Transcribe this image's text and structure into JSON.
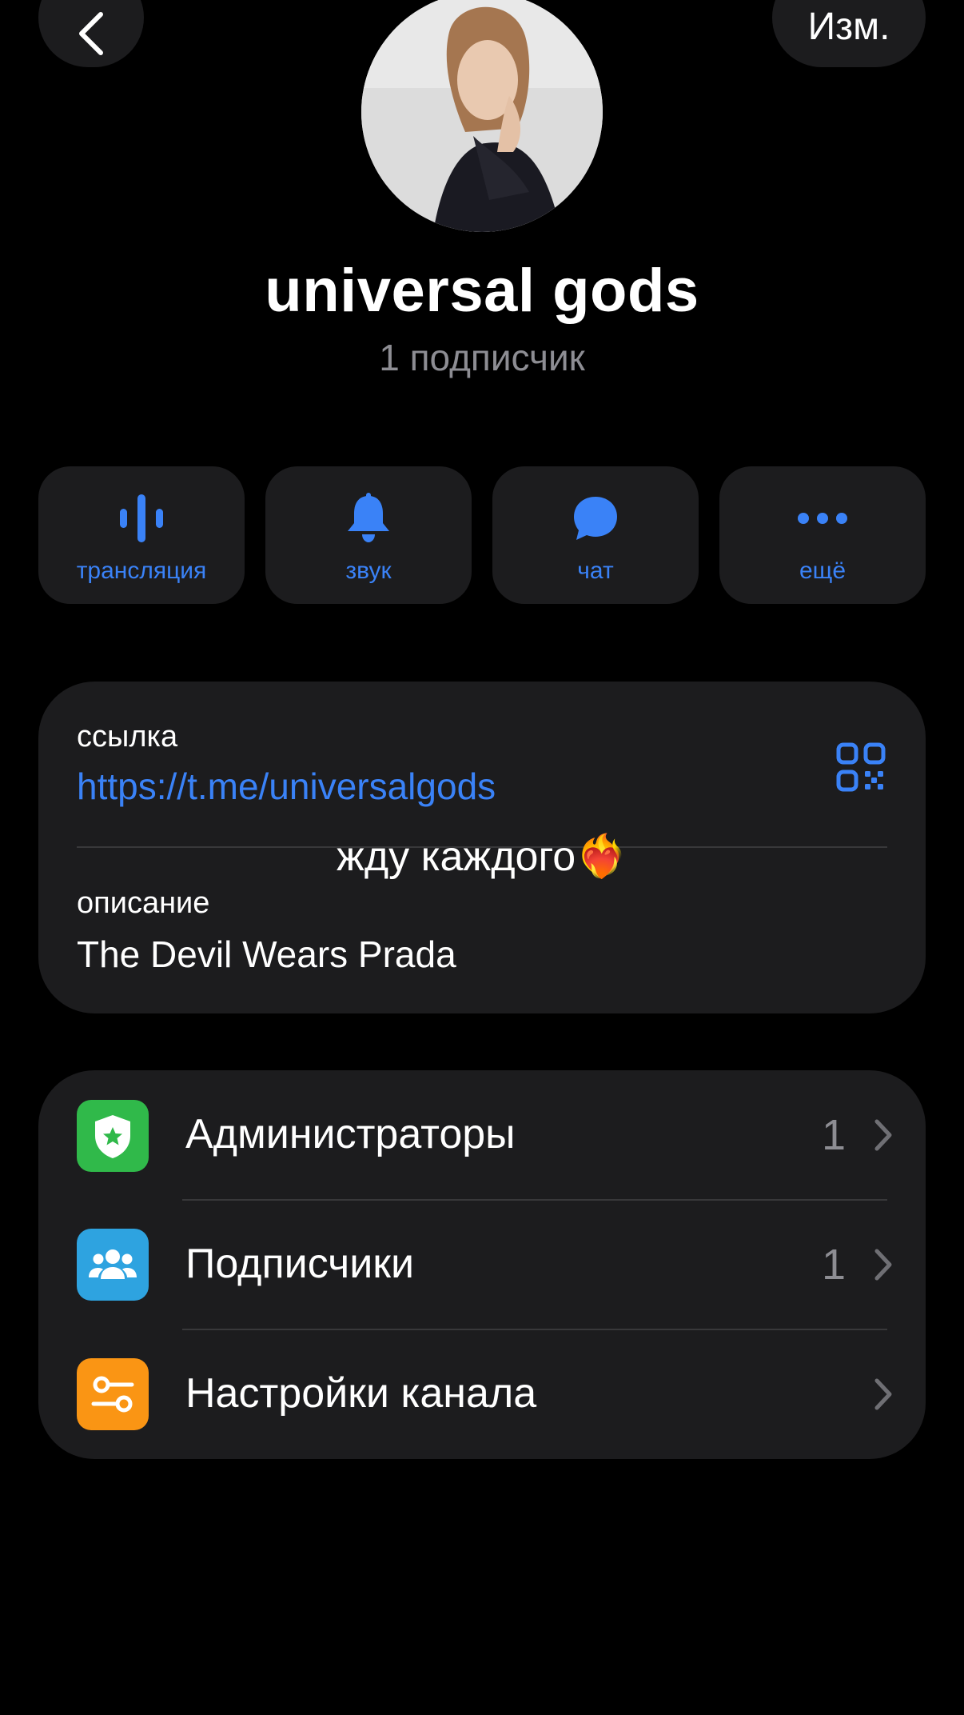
{
  "header": {
    "edit_label": "Изм."
  },
  "channel": {
    "name": "universal gods",
    "subscribers": "1 подписчик"
  },
  "actions": [
    {
      "label": "трансляция",
      "icon": "waveform-icon"
    },
    {
      "label": "звук",
      "icon": "bell-icon"
    },
    {
      "label": "чат",
      "icon": "chat-bubble-icon"
    },
    {
      "label": "ещё",
      "icon": "more-dots-icon"
    }
  ],
  "info": {
    "link_label": "ссылка",
    "link_value": "https://t.me/universalgods",
    "overlay_caption": "жду каждого❤️‍🔥",
    "description_label": "описание",
    "description_value": "The Devil Wears Prada"
  },
  "menu": [
    {
      "label": "Администраторы",
      "count": "1",
      "icon": "shield-star-icon",
      "color": "#30b94a"
    },
    {
      "label": "Подписчики",
      "count": "1",
      "icon": "people-icon",
      "color": "#2ea3e0"
    },
    {
      "label": "Настройки канала",
      "count": "",
      "icon": "settings-sliders-icon",
      "color": "#fa9514"
    }
  ],
  "colors": {
    "accent": "#3a82f7",
    "card": "#1c1c1e",
    "secondary_text": "#8d8d93"
  }
}
